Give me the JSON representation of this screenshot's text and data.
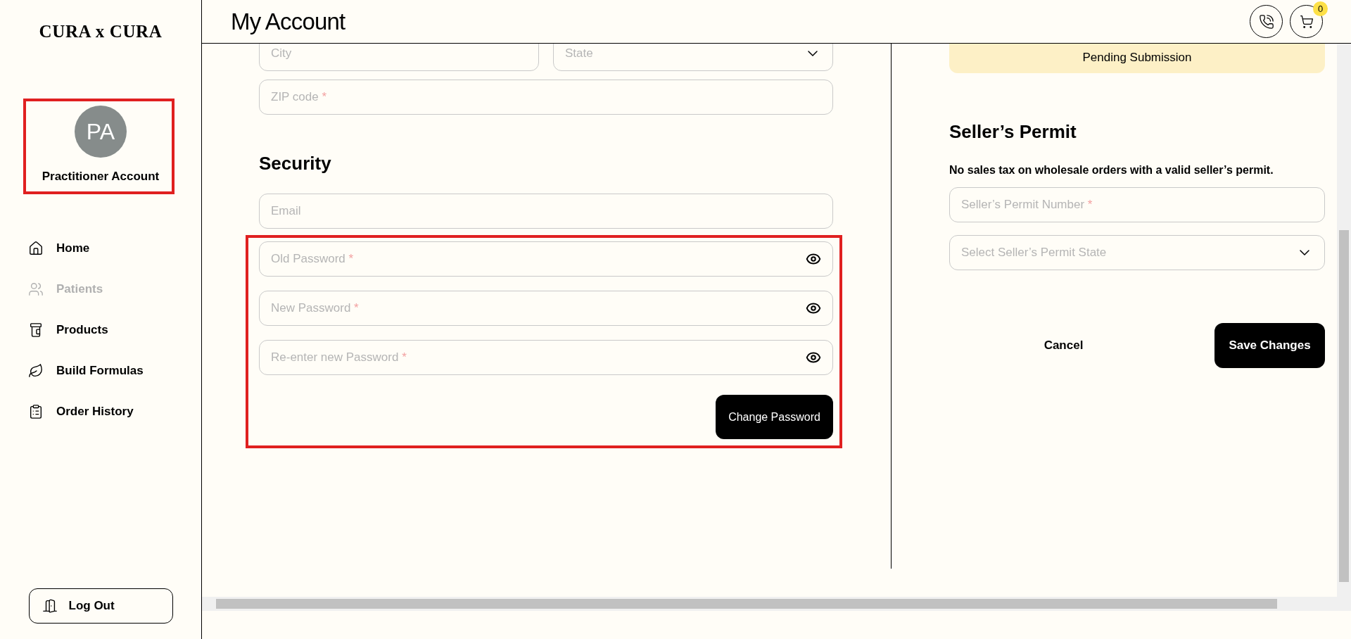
{
  "brand": {
    "logo": "CURA x CURA"
  },
  "profile": {
    "initials": "PA",
    "name": "Practitioner Account"
  },
  "nav": [
    {
      "label": "Home",
      "disabled": false
    },
    {
      "label": "Patients",
      "disabled": true
    },
    {
      "label": "Products",
      "disabled": false
    },
    {
      "label": "Build Formulas",
      "disabled": false
    },
    {
      "label": "Order History",
      "disabled": false
    }
  ],
  "logout": {
    "label": "Log Out"
  },
  "header": {
    "title": "My Account",
    "cart_count": "0"
  },
  "address": {
    "fields": [
      {
        "placeholder": "City",
        "kind": "text"
      },
      {
        "placeholder": "State",
        "kind": "select"
      }
    ],
    "zip": {
      "placeholder": "ZIP code",
      "required_mark": "*"
    }
  },
  "security": {
    "heading": "Security",
    "email": {
      "placeholder": "Email"
    },
    "passwords": [
      {
        "placeholder": "Old Password",
        "required_mark": "*"
      },
      {
        "placeholder": "New Password",
        "required_mark": "*"
      },
      {
        "placeholder": "Re-enter new Password",
        "required_mark": "*"
      }
    ],
    "button": "Change Password"
  },
  "status": {
    "label": "Pending Submission"
  },
  "permit": {
    "heading": "Seller’s Permit",
    "description": "No sales tax on wholesale orders with a valid seller’s permit.",
    "fields": [
      {
        "placeholder": "Seller’s Permit Number",
        "required_mark": "*",
        "kind": "text"
      },
      {
        "placeholder": "Select Seller’s Permit State",
        "kind": "select"
      }
    ]
  },
  "actions": {
    "cancel": "Cancel",
    "save": "Save Changes"
  }
}
